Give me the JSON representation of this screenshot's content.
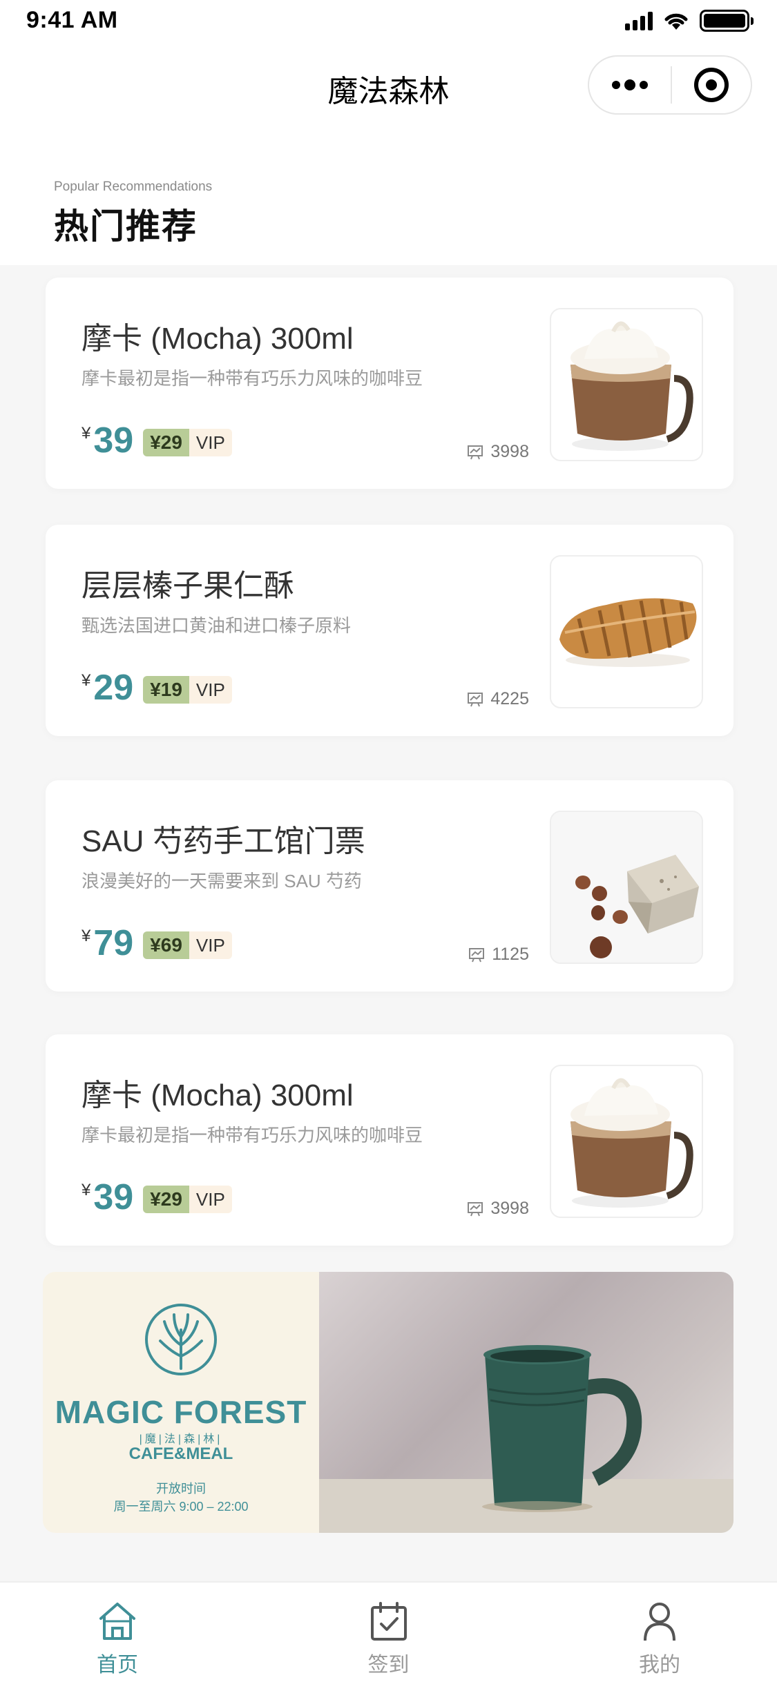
{
  "status_bar": {
    "time": "9:41 AM"
  },
  "nav": {
    "title": "魔法森林"
  },
  "section": {
    "subtitle_en": "Popular Recommendations",
    "title": "热门推荐"
  },
  "products": [
    {
      "title": "摩卡 (Mocha) 300ml",
      "desc": "摩卡最初是指一种带有巧乐力风味的咖啡豆",
      "currency": "¥",
      "price": "39",
      "vip_price": "¥29",
      "vip_label": "VIP",
      "sales": "3998",
      "image": "mocha-cup"
    },
    {
      "title": "层层榛子果仁酥",
      "desc": "甄选法国进口黄油和进口榛子原料",
      "currency": "¥",
      "price": "29",
      "vip_price": "¥19",
      "vip_label": "VIP",
      "sales": "4225",
      "image": "hazelnut-pastry"
    },
    {
      "title": "SAU 芍药手工馆门票",
      "desc": "浪漫美好的一天需要来到 SAU 芍药",
      "currency": "¥",
      "price": "79",
      "vip_price": "¥69",
      "vip_label": "VIP",
      "sales": "1125",
      "image": "handmade-soap"
    },
    {
      "title": "摩卡 (Mocha) 300ml",
      "desc": "摩卡最初是指一种带有巧乐力风味的咖啡豆",
      "currency": "¥",
      "price": "39",
      "vip_price": "¥29",
      "vip_label": "VIP",
      "sales": "3998",
      "image": "mocha-cup"
    }
  ],
  "banner": {
    "brand": "MAGIC FOREST",
    "brand_cn": "|魔|法|森|林|",
    "sub": "CAFE&MEAL",
    "hours_label": "开放时间",
    "hours": "周一至周六 9:00 – 22:00"
  },
  "tabbar": [
    {
      "label": "首页",
      "icon": "home-icon",
      "active": true
    },
    {
      "label": "签到",
      "icon": "calendar-check-icon",
      "active": false
    },
    {
      "label": "我的",
      "icon": "user-icon",
      "active": false
    }
  ],
  "colors": {
    "accent": "#3f8f97",
    "vip_green": "#b8cc97",
    "vip_cream": "#fbf1e4",
    "background": "#f6f6f6"
  }
}
